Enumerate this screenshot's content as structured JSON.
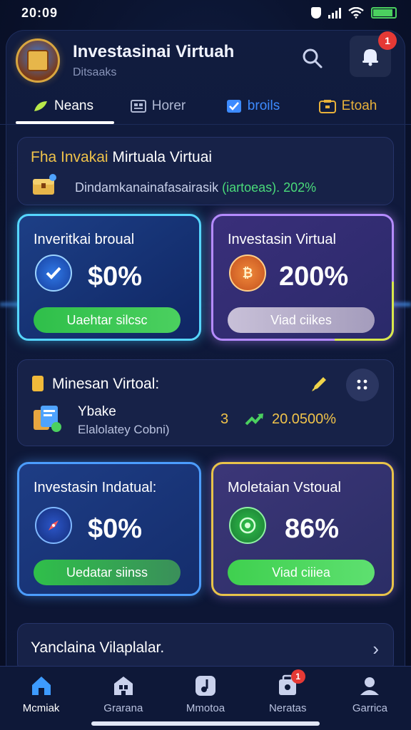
{
  "status_bar": {
    "time": "20:09",
    "battery_percent": 0.9
  },
  "header": {
    "title": "Investasinai Virtuah",
    "subtitle": "Ditsaaks",
    "notification_count": "1"
  },
  "tabs": [
    {
      "label": "Neans",
      "icon": "leaf-icon",
      "color": "#b9e84a"
    },
    {
      "label": "Horer",
      "icon": "grid-icon",
      "color": "#aeb7d2"
    },
    {
      "label": "broils",
      "icon": "check-box-icon",
      "color": "#3d8bff"
    },
    {
      "label": "Etoah",
      "icon": "wallet-icon",
      "color": "#e8b13a"
    }
  ],
  "info": {
    "title_a": "Fha Invakai",
    "title_b": " Mirtuala Virtuai",
    "text": "Dindamkanainafasairasik",
    "tag": "(iartoeas). 202%"
  },
  "cards": [
    {
      "title": "Inveritkai broual",
      "value": "$0%",
      "button": "Uaehtar silcsc",
      "icon": "check-shield-icon",
      "accent": "#56d6ff"
    },
    {
      "title": "Investasin Virtual",
      "value": "200%",
      "button": "Viad ciikes",
      "icon": "coin-icon",
      "accent": "#b58bff"
    },
    {
      "title": "Investasin Indatual:",
      "value": "$0%",
      "button": "Uedatar siinss",
      "icon": "compass-icon",
      "accent": "#4c9dff"
    },
    {
      "title": "Moletaian Vstoual",
      "value": "86%",
      "button": "Viad ciiiea",
      "icon": "target-icon",
      "accent": "#e8c34a"
    }
  ],
  "mid": {
    "title": "Minesan Virtoal:",
    "item_name": "Ybake",
    "item_desc": "Elalolatey Cobni)",
    "count": "3",
    "value": "20.0500%"
  },
  "link_card": {
    "title": "Yanclaina Vilaplalar."
  },
  "bottom_nav": [
    {
      "label": "Mcmiak",
      "icon": "home-icon"
    },
    {
      "label": "Grarana",
      "icon": "store-icon"
    },
    {
      "label": "Mmotoa",
      "icon": "music-icon"
    },
    {
      "label": "Neratas",
      "icon": "bag-icon",
      "badge": "1"
    },
    {
      "label": "Garrica",
      "icon": "profile-icon"
    }
  ]
}
